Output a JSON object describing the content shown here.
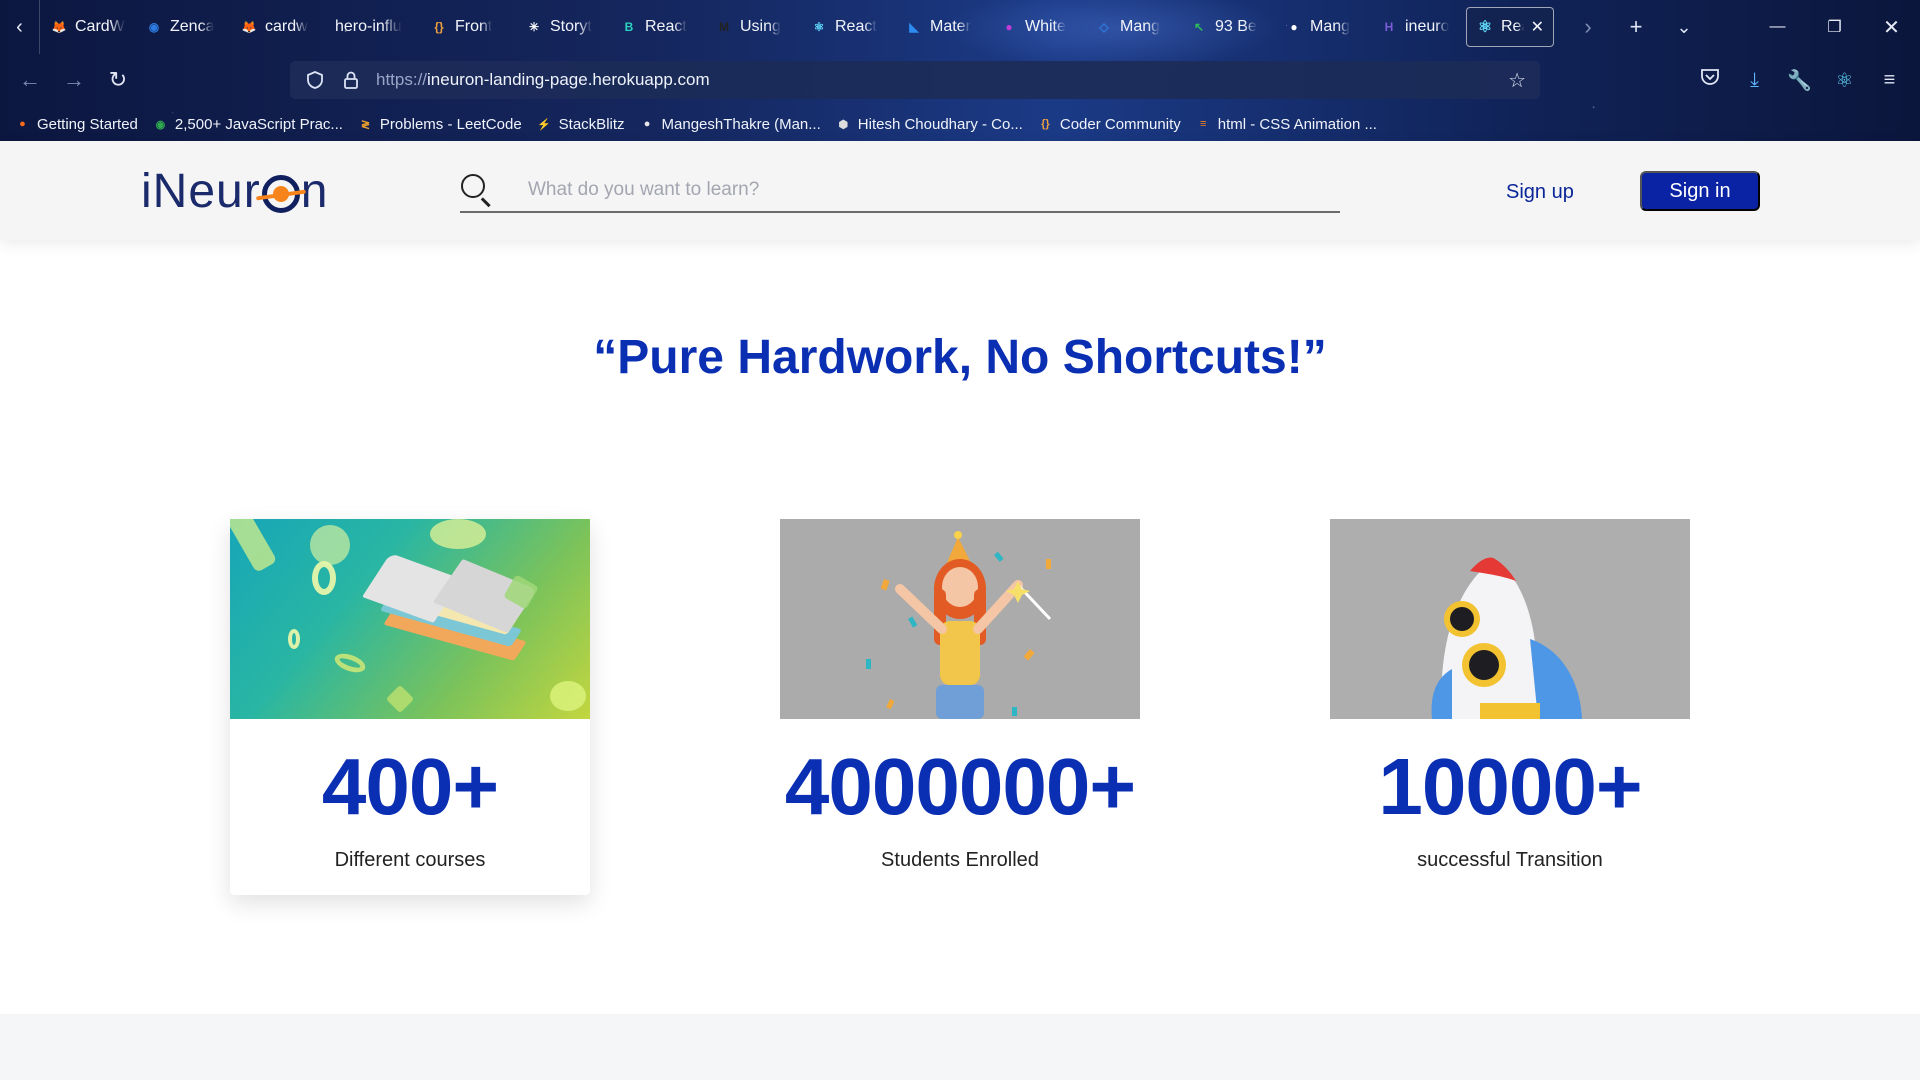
{
  "browser": {
    "tabs": [
      {
        "label": "CardW",
        "icon": "fox-icon",
        "color": "#f08c2a"
      },
      {
        "label": "Zenca",
        "icon": "globe-icon",
        "color": "#2d7be0"
      },
      {
        "label": "cardw",
        "icon": "fox-icon",
        "color": "#f08c2a"
      },
      {
        "label": "hero-influ",
        "icon": "",
        "color": ""
      },
      {
        "label": "Front",
        "icon": "braces-icon",
        "color": "#f0a03c"
      },
      {
        "label": "Storyt",
        "icon": "spark-icon",
        "color": "#ffffff"
      },
      {
        "label": "React",
        "icon": "b-icon",
        "color": "#2bd4c0"
      },
      {
        "label": "Using",
        "icon": "m-icon",
        "color": "#222222"
      },
      {
        "label": "React",
        "icon": "react-icon",
        "color": "#61dafb"
      },
      {
        "label": "Mater",
        "icon": "material-icon",
        "color": "#2d8cf0"
      },
      {
        "label": "White",
        "icon": "drop-icon",
        "color": "#c23bd4"
      },
      {
        "label": "Mang",
        "icon": "diamond-icon",
        "color": "#2d7be0"
      },
      {
        "label": "93 Be",
        "icon": "cursor-icon",
        "color": "#2fbf5a"
      },
      {
        "label": "Mang",
        "icon": "github-icon",
        "color": "#ffffff"
      },
      {
        "label": "ineuro",
        "icon": "heroku-icon",
        "color": "#7b5bd6"
      }
    ],
    "active_tab": {
      "label": "Rea",
      "icon": "react-icon",
      "color": "#61dafb"
    },
    "url_scheme": "https://",
    "url_host": "ineuron-landing-page.herokuapp.com",
    "bookmarks": [
      {
        "label": "Getting Started",
        "icon": "firefox-icon",
        "color": "#f26a1b"
      },
      {
        "label": "2,500+ JavaScript Prac...",
        "icon": "owl-icon",
        "color": "#2fa84f"
      },
      {
        "label": "Problems - LeetCode",
        "icon": "leetcode-icon",
        "color": "#f0a32a"
      },
      {
        "label": "StackBlitz",
        "icon": "bolt-icon",
        "color": "#2b8cf0"
      },
      {
        "label": "MangeshThakre (Man...",
        "icon": "github-icon",
        "color": "#e8e8e8"
      },
      {
        "label": "Hitesh Choudhary - Co...",
        "icon": "hex-icon",
        "color": "#dddddd"
      },
      {
        "label": "Coder Community",
        "icon": "braces-icon",
        "color": "#f0a03c"
      },
      {
        "label": "html - CSS Animation ...",
        "icon": "stack-icon",
        "color": "#f48024"
      }
    ]
  },
  "header": {
    "logo_prefix": "iNeur",
    "logo_suffix": "n",
    "search_placeholder": "What do you want to learn?",
    "signup_label": "Sign up",
    "signin_label": "Sign in"
  },
  "hero": {
    "headline": "“Pure Hardwork, No Shortcuts!”"
  },
  "stats": [
    {
      "value": "400+",
      "caption": "Different courses",
      "illustration": "books"
    },
    {
      "value": "4000000+",
      "caption": "Students Enrolled",
      "illustration": "party-girl"
    },
    {
      "value": "10000+",
      "caption": "successful Transition",
      "illustration": "rocket"
    }
  ],
  "colors": {
    "brand_blue": "#0a2fb3",
    "signin_bg": "#0a22a4",
    "header_bg": "#f5f5f5"
  }
}
